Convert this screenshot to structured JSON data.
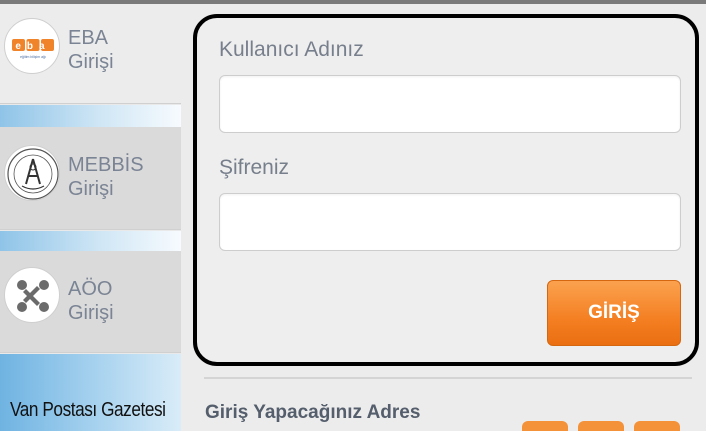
{
  "sidebar": {
    "items": [
      {
        "label": "EBA\nGirişi",
        "icon": "eba-logo-icon"
      },
      {
        "label": "MEBBİS\nGirişi",
        "icon": "meb-emblem-icon"
      },
      {
        "label": "AÖO\nGirişi",
        "icon": "aoo-logo-icon"
      }
    ],
    "eba_logo_text": "eba",
    "eba_logo_subtext": "eğitim bilişim ağı"
  },
  "login": {
    "username_label": "Kullanıcı Adınız",
    "username_value": "",
    "password_label": "Şifreniz",
    "password_value": "",
    "submit_label": "GİRİŞ"
  },
  "address_section": {
    "title": "Giriş Yapacağınız Adres"
  },
  "watermark": "Van Postası Gazetesi",
  "colors": {
    "accent_orange": "#f47f22",
    "panel_border": "#000000",
    "sidebar_blue": "#8fc4e8",
    "label_gray": "#777f8c"
  }
}
